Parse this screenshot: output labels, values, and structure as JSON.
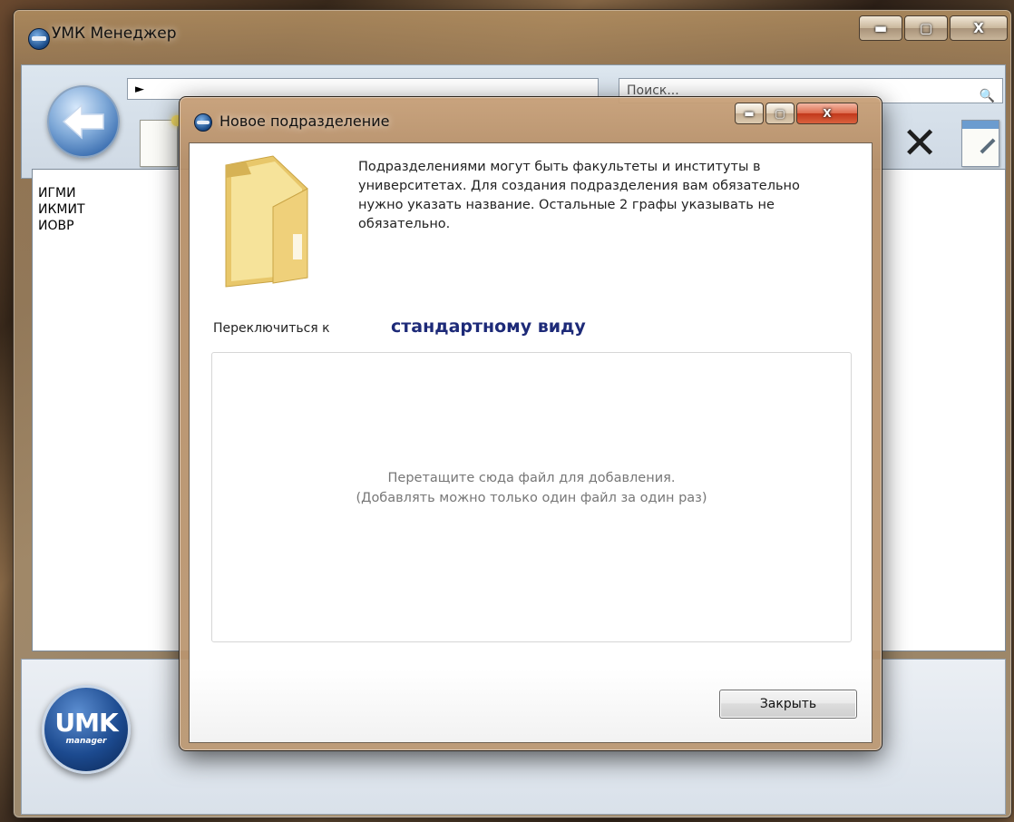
{
  "main_window": {
    "title": "УМК Менеджер",
    "caption_buttons": {
      "minimize": "▬",
      "maximize": "▢",
      "close": "X"
    }
  },
  "toolbar": {
    "path_value": "►",
    "search_placeholder": "Поиск..."
  },
  "list": {
    "items": [
      "ИГМИ",
      "ИКМИТ",
      "ИОВР"
    ]
  },
  "logo": {
    "main": "UMK",
    "sub": "manager"
  },
  "dialog": {
    "title": "Новое подразделение",
    "caption_buttons": {
      "minimize": "▬",
      "maximize": "▢",
      "close": "X"
    },
    "description": "Подразделениями могут быть факультеты и институты в университетах. Для создания подразделения вам обязательно нужно указать название. Остальные 2 графы указывать не обязательно.",
    "switch_label": "Переключиться к",
    "switch_link": "стандартному виду",
    "drop_zone": {
      "line1": "Перетащите сюда файл для добавления.",
      "line2": "(Добавлять можно только один файл за один раз)"
    },
    "close_button": "Закрыть"
  }
}
